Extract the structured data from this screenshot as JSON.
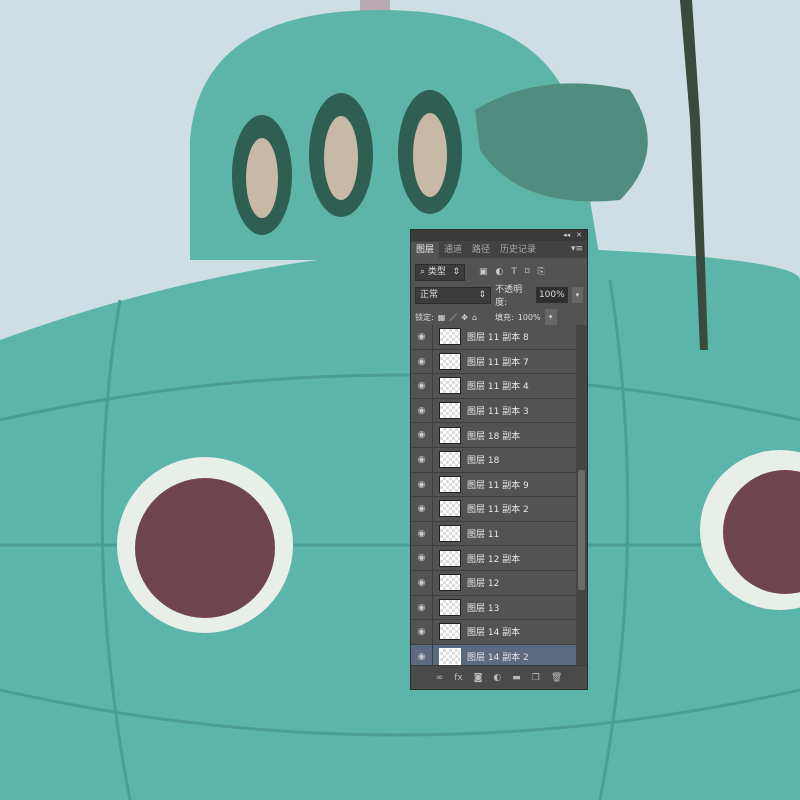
{
  "panel": {
    "tabs": [
      "图层",
      "通道",
      "路径",
      "历史记录"
    ],
    "active_tab": 0,
    "filter_kind": "类型",
    "blend_mode": "正常",
    "opacity_label": "不透明度:",
    "opacity_value": "100%",
    "lock_label": "锁定:",
    "fill_label": "填充:",
    "fill_value": "100%",
    "layers": [
      "图层 11 副本 8",
      "图层 11 副本 7",
      "图层 11 副本 4",
      "图层 11 副本 3",
      "图层 18 副本",
      "图层 18",
      "图层 11 副本 9",
      "图层 11 副本 2",
      "图层 11",
      "图层 12 副本",
      "图层 12",
      "图层 13",
      "图层 14 副本",
      "图层 14 副本 2"
    ],
    "selected_layer": 13
  },
  "colors": {
    "accent_selected": "#5b6a80",
    "panel_bg": "#535353",
    "submarine": "#5bb5aa"
  }
}
